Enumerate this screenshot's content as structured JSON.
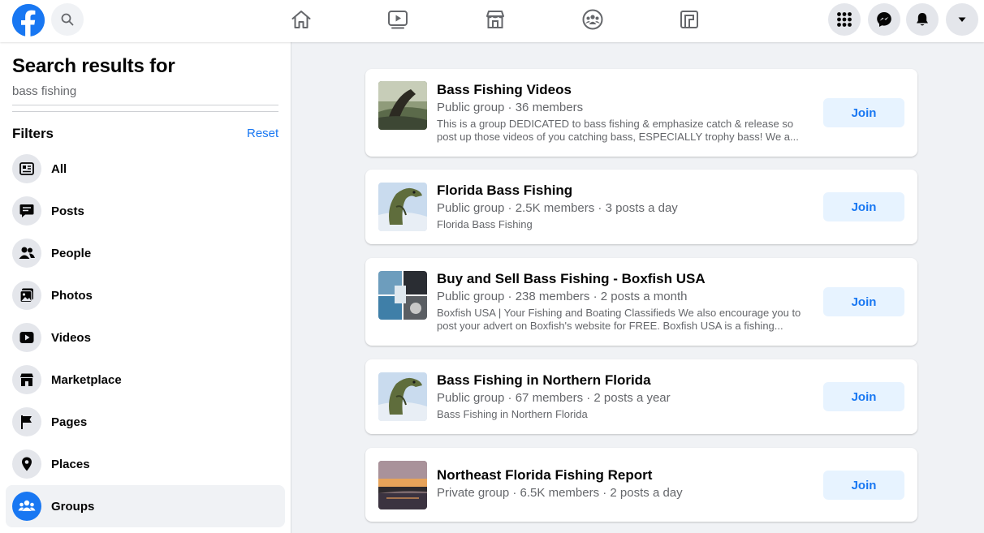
{
  "sidebar": {
    "title": "Search results for",
    "query": "bass fishing",
    "filters_label": "Filters",
    "reset_label": "Reset",
    "items": [
      {
        "label": "All",
        "icon": "all-results-icon"
      },
      {
        "label": "Posts",
        "icon": "posts-icon"
      },
      {
        "label": "People",
        "icon": "people-icon"
      },
      {
        "label": "Photos",
        "icon": "photos-icon"
      },
      {
        "label": "Videos",
        "icon": "videos-icon"
      },
      {
        "label": "Marketplace",
        "icon": "marketplace-icon"
      },
      {
        "label": "Pages",
        "icon": "pages-flag-icon"
      },
      {
        "label": "Places",
        "icon": "places-pin-icon"
      },
      {
        "label": "Groups",
        "icon": "groups-icon",
        "active": true
      }
    ]
  },
  "results": [
    {
      "title": "Bass Fishing Videos",
      "meta": "Public group · 36 members",
      "description": "This is a group DEDICATED to bass fishing & emphasize catch & release so post up those videos of you catching bass, ESPECIALLY trophy bass! We a...",
      "join_label": "Join"
    },
    {
      "title": "Florida Bass Fishing",
      "meta": "Public group · 2.5K members · 3 posts a day",
      "description": "Florida Bass Fishing",
      "join_label": "Join"
    },
    {
      "title": "Buy and Sell Bass Fishing - Boxfish USA",
      "meta": "Public group · 238 members · 2 posts a month",
      "description": "Boxfish USA | Your Fishing and Boating Classifieds We also encourage you to post your advert on Boxfish's website for FREE. Boxfish USA is a fishing...",
      "join_label": "Join"
    },
    {
      "title": "Bass Fishing in Northern Florida",
      "meta": "Public group · 67 members · 2 posts a year",
      "description": "Bass Fishing in Northern Florida",
      "join_label": "Join"
    },
    {
      "title": "Northeast Florida Fishing Report",
      "meta": "Private group · 6.5K members · 2 posts a day",
      "description": "",
      "join_label": "Join"
    }
  ],
  "colors": {
    "brand": "#1877f2",
    "join_bg": "#e7f3ff",
    "page_bg": "#f0f2f5",
    "secondary_text": "#65676b"
  }
}
